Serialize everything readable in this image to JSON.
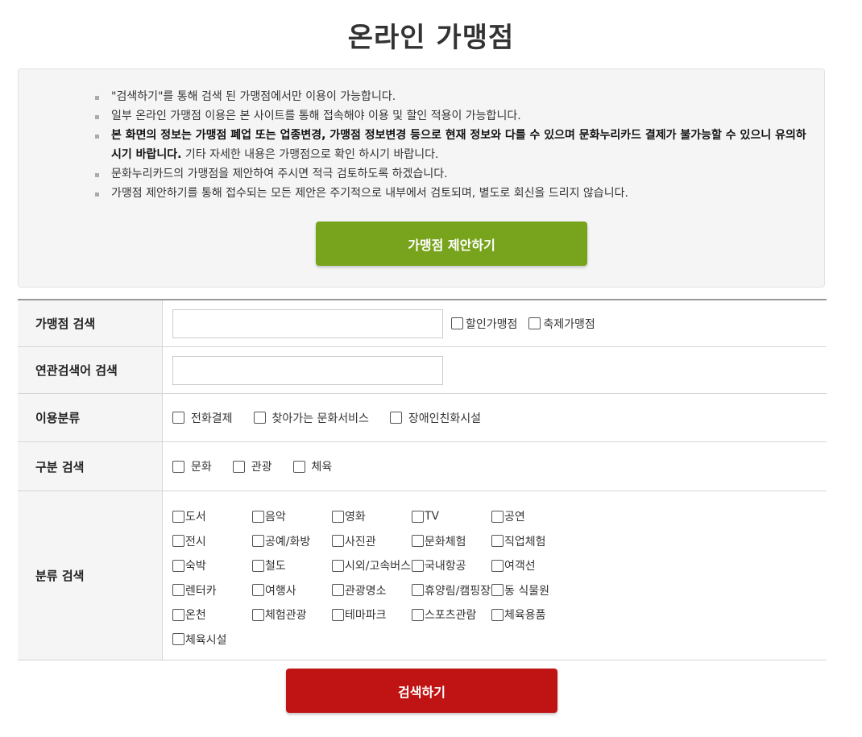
{
  "page": {
    "title": "온라인 가맹점"
  },
  "notice": {
    "items": [
      {
        "text": "\"검색하기\"를 통해 검색 된 가맹점에서만 이용이 가능합니다."
      },
      {
        "text": "일부 온라인 가맹점 이용은 본 사이트를 통해 접속해야 이용 및 할인 적용이 가능합니다."
      },
      {
        "bold": "본 화면의 정보는 가맹점 폐업 또는 업종변경, 가맹점 정보변경 등으로 현재 정보와 다를 수 있으며 문화누리카드 결제가 불가능할 수 있으니 유의하시기 바랍니다.",
        "text": " 기타 자세한 내용은 가맹점으로 확인 하시기 바랍니다."
      },
      {
        "text": "문화누리카드의 가맹점을 제안하여 주시면 적극 검토하도록 하겠습니다."
      },
      {
        "text": "가맹점 제안하기를 통해 접수되는 모든 제안은 주기적으로 내부에서 검토되며, 별도로 회신을 드리지 않습니다."
      }
    ],
    "propose_button": "가맹점 제안하기"
  },
  "form": {
    "store_search": {
      "label": "가맹점 검색",
      "input_value": "",
      "options": [
        "할인가맹점",
        "축제가맹점"
      ]
    },
    "keyword_search": {
      "label": "연관검색어 검색",
      "input_value": ""
    },
    "usage_type": {
      "label": "이용분류",
      "options": [
        "전화결제",
        "찾아가는 문화서비스",
        "장애인친화시설"
      ]
    },
    "division": {
      "label": "구분 검색",
      "options": [
        "문화",
        "관광",
        "체육"
      ]
    },
    "category": {
      "label": "분류 검색",
      "options": [
        "도서",
        "음악",
        "영화",
        "TV",
        "공연",
        "전시",
        "공예/화방",
        "사진관",
        "문화체험",
        "직업체험",
        "숙박",
        "철도",
        "시외/고속버스",
        "국내항공",
        "여객선",
        "렌터카",
        "여행사",
        "관광명소",
        "휴양림/캠핑장",
        "동 식물원",
        "온천",
        "체험관광",
        "테마파크",
        "스포츠관람",
        "체육용품",
        "체육시설"
      ]
    }
  },
  "search_button": "검색하기",
  "colors": {
    "propose": "#78a31c",
    "search": "#c01414"
  }
}
